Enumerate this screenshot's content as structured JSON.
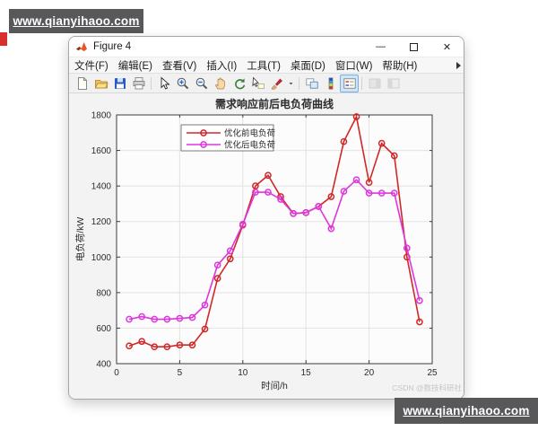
{
  "watermarks": {
    "top_banner": "www.qianyihaoo.com",
    "bottom_banner": "www.qianyihaoo.com",
    "csdn": "CSDN @数技科研社"
  },
  "window": {
    "title": "Figure 4",
    "controls": {
      "minimize": "—",
      "maximize": "",
      "close": "✕"
    },
    "menu": [
      "文件(F)",
      "编辑(E)",
      "查看(V)",
      "插入(I)",
      "工具(T)",
      "桌面(D)",
      "窗口(W)",
      "帮助(H)"
    ],
    "toolbar": [
      "new-file",
      "open-folder",
      "save",
      "print",
      "separator",
      "edit-cursor",
      "zoom-in",
      "zoom-out",
      "pan-hand",
      "rotate-3d",
      "data-cursor",
      "brush",
      "brush-dropdown",
      "separator",
      "link-plots",
      "insert-colorbar",
      "insert-legend",
      "separator",
      "hide-plot-tools",
      "show-plot-tools"
    ],
    "active_tool": "insert-legend"
  },
  "chart_data": {
    "type": "line",
    "title": "需求响应前后电负荷曲线",
    "xlabel": "时间/h",
    "ylabel": "电负荷/kW",
    "xlim": [
      0,
      25
    ],
    "ylim": [
      400,
      1800
    ],
    "xticks": [
      0,
      5,
      10,
      15,
      20,
      25
    ],
    "yticks": [
      400,
      600,
      800,
      1000,
      1200,
      1400,
      1600,
      1800
    ],
    "grid": true,
    "legend_position": "top-left",
    "x": [
      1,
      2,
      3,
      4,
      5,
      6,
      7,
      8,
      9,
      10,
      11,
      12,
      13,
      14,
      15,
      16,
      17,
      18,
      19,
      20,
      21,
      22,
      23,
      24
    ],
    "series": [
      {
        "name": "优化前电负荷",
        "color": "#d02828",
        "marker": "o",
        "values": [
          500,
          525,
          495,
          495,
          505,
          505,
          595,
          880,
          990,
          1180,
          1400,
          1460,
          1340,
          1245,
          1250,
          1285,
          1340,
          1650,
          1790,
          1420,
          1640,
          1570,
          1000,
          635
        ]
      },
      {
        "name": "优化后电负荷",
        "color": "#dd36dd",
        "marker": "o",
        "values": [
          650,
          665,
          650,
          650,
          655,
          660,
          730,
          955,
          1035,
          1185,
          1365,
          1365,
          1325,
          1245,
          1250,
          1285,
          1160,
          1370,
          1435,
          1360,
          1360,
          1360,
          1050,
          755
        ]
      }
    ]
  }
}
